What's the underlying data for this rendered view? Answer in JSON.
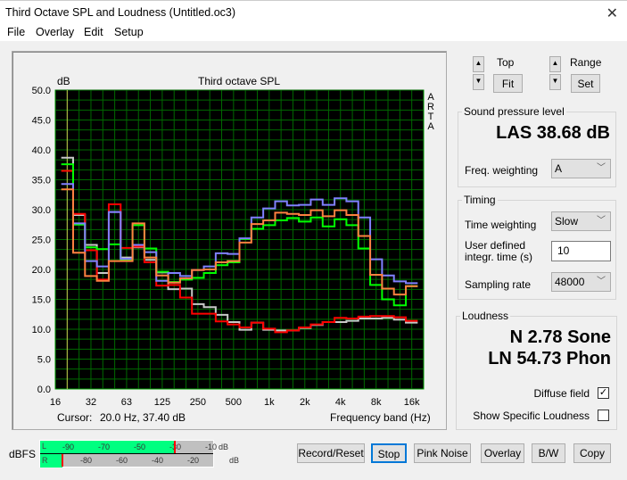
{
  "window": {
    "title": "Third Octave SPL and Loudness (Untitled.oc3)",
    "close_icon": "close-icon"
  },
  "menu": [
    "File",
    "Overlay",
    "Edit",
    "Setup"
  ],
  "controls": {
    "top_label": "Top",
    "fit_label": "Fit",
    "range_label": "Range",
    "set_label": "Set"
  },
  "spl": {
    "group_label": "Sound pressure level",
    "value": "LAS 38.68 dB",
    "freq_weighting_label": "Freq. weighting",
    "freq_weighting": "A"
  },
  "timing": {
    "group_label": "Timing",
    "time_weighting_label": "Time weighting",
    "time_weighting": "Slow",
    "integr_label_1": "User defined",
    "integr_label_2": "integr. time (s)",
    "integr_value": "10",
    "sampling_rate_label": "Sampling rate",
    "sampling_rate": "48000"
  },
  "loudness": {
    "group_label": "Loudness",
    "n_value": "N 2.78 Sone",
    "ln_value": "LN 54.73 Phon",
    "diffuse_label": "Diffuse field",
    "diffuse_checked": true,
    "specific_label": "Show Specific Loudness",
    "specific_checked": false
  },
  "cursor": {
    "label": "Cursor:",
    "value": "20.0 Hz, 37.40 dB"
  },
  "meter": {
    "label": "dBFS",
    "L_label": "L",
    "R_label": "R",
    "L_ticks": [
      "-90",
      "-70",
      "-50",
      "-30",
      "-10",
      "dB"
    ],
    "R_ticks": [
      "-80",
      "-60",
      "-40",
      "-20",
      "dB"
    ],
    "L_level_dbfs": -23,
    "R_level_dbfs": -87
  },
  "buttons": {
    "record": "Record/Reset",
    "stop": "Stop",
    "pink": "Pink Noise",
    "overlay": "Overlay",
    "bw": "B/W",
    "copy": "Copy"
  },
  "chart_data": {
    "type": "line",
    "title": "Third octave SPL",
    "ylabel": "dB",
    "xlabel": "Frequency band (Hz)",
    "side_label": [
      "A",
      "R",
      "T",
      "A"
    ],
    "ylim": [
      0,
      50
    ],
    "yticks": [
      "0.0",
      "5.0",
      "10.0",
      "15.0",
      "20.0",
      "25.0",
      "30.0",
      "35.0",
      "40.0",
      "45.0",
      "50.0"
    ],
    "xtick_labels": [
      "16",
      "32",
      "63",
      "125",
      "250",
      "500",
      "1k",
      "2k",
      "4k",
      "8k",
      "16k"
    ],
    "bands": [
      "20",
      "25",
      "31.5",
      "40",
      "50",
      "63",
      "80",
      "100",
      "125",
      "160",
      "200",
      "250",
      "315",
      "400",
      "500",
      "630",
      "800",
      "1k",
      "1.25k",
      "1.6k",
      "2k",
      "2.5k",
      "3.15k",
      "4k",
      "5k",
      "6.3k",
      "8k",
      "10k",
      "12.5k",
      "16k"
    ],
    "grid": true,
    "cursor_band": "20",
    "series": [
      {
        "color": "#c8c8c8",
        "values": [
          38.7,
          29.1,
          24.1,
          19.4,
          29.6,
          22.0,
          23.7,
          21.6,
          19.5,
          16.7,
          16.8,
          14.2,
          13.7,
          12.4,
          11.2,
          9.9,
          11.1,
          9.9,
          9.8,
          9.8,
          10.2,
          10.7,
          11.2,
          11.2,
          11.4,
          11.8,
          11.8,
          11.9,
          11.6,
          11.1
        ]
      },
      {
        "color": "#ff0000",
        "values": [
          36.5,
          29.3,
          23.2,
          18.3,
          30.9,
          23.6,
          23.8,
          21.2,
          17.3,
          17.4,
          15.3,
          12.6,
          12.6,
          11.3,
          10.8,
          10.3,
          11.1,
          10.1,
          9.5,
          9.8,
          10.3,
          10.8,
          11.2,
          11.9,
          11.8,
          12.1,
          12.2,
          12.2,
          12.0,
          11.4
        ]
      },
      {
        "color": "#00ff00",
        "values": [
          37.6,
          27.5,
          23.7,
          23.4,
          24.2,
          21.6,
          27.4,
          23.5,
          19.6,
          17.9,
          18.3,
          18.6,
          19.4,
          20.7,
          21.2,
          25.1,
          26.8,
          27.4,
          28.2,
          28.6,
          28.0,
          28.7,
          27.2,
          28.4,
          27.4,
          23.5,
          17.4,
          15.0,
          14.0,
          17.2
        ]
      },
      {
        "color": "#8080ff",
        "values": [
          34.3,
          27.7,
          21.4,
          20.5,
          29.6,
          21.8,
          24.1,
          22.9,
          18.1,
          19.4,
          18.9,
          19.9,
          20.5,
          22.7,
          22.6,
          25.2,
          28.7,
          30.2,
          31.4,
          30.7,
          30.8,
          31.7,
          30.8,
          31.9,
          31.4,
          28.7,
          21.7,
          19.0,
          18.0,
          17.7
        ]
      },
      {
        "color": "#ff8040",
        "values": [
          33.4,
          22.8,
          18.9,
          18.1,
          21.4,
          21.4,
          27.7,
          22.0,
          19.0,
          17.8,
          18.5,
          19.9,
          20.0,
          21.2,
          21.4,
          24.5,
          27.6,
          28.2,
          29.5,
          29.3,
          29.1,
          29.9,
          28.9,
          29.9,
          29.1,
          25.6,
          19.1,
          16.8,
          15.8,
          17.2
        ]
      }
    ]
  }
}
